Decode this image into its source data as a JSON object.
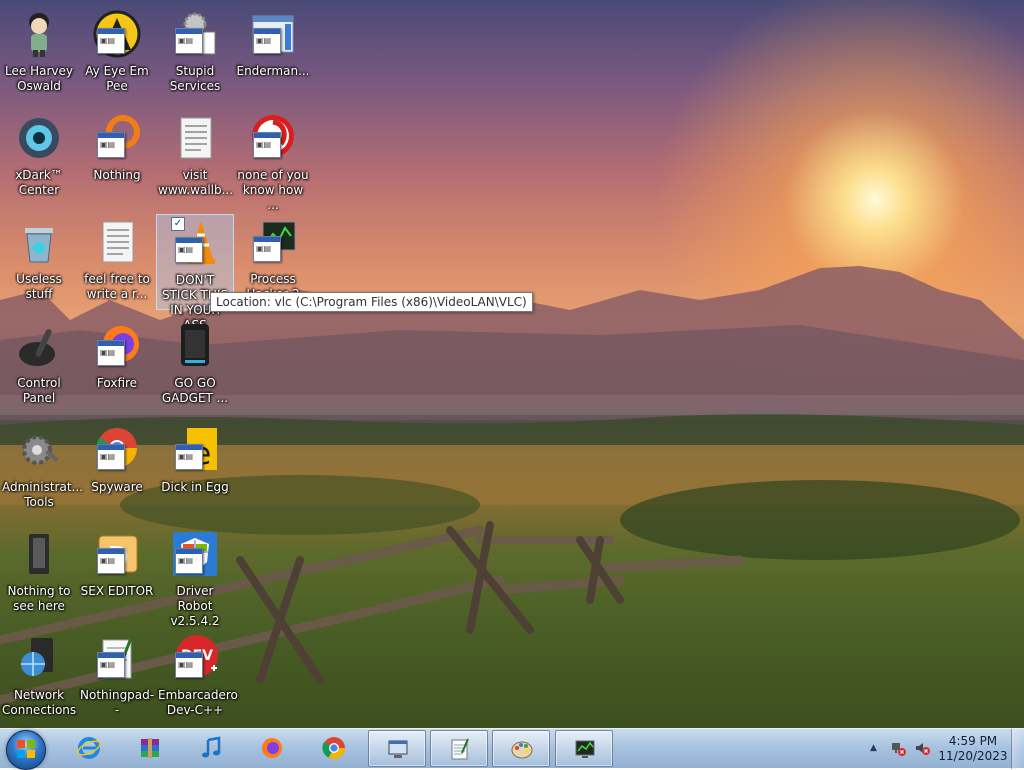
{
  "desktop": {
    "icons": [
      {
        "label": "Lee Harvey Oswald",
        "icon": "character-icon"
      },
      {
        "label": "Ay Eye Em Pee",
        "icon": "aim-icon"
      },
      {
        "label": "Stupid Services",
        "icon": "services-gear-icon"
      },
      {
        "label": "Enderman...",
        "icon": "window-app-icon"
      },
      {
        "label": "xDark™ Center",
        "icon": "dark-center-icon"
      },
      {
        "label": "Nothing",
        "icon": "orange-ring-icon"
      },
      {
        "label": "visit www.wallb...",
        "icon": "text-document-icon"
      },
      {
        "label": "none of you know how ...",
        "icon": "red-app-icon"
      },
      {
        "label": "Useless stuff",
        "icon": "recycle-bin-icon"
      },
      {
        "label": "feel free to write a r...",
        "icon": "text-document-icon"
      },
      {
        "label": "DON'T STICK THIS IN YOUR ASS",
        "icon": "vlc-cone-icon"
      },
      {
        "label": "Process Hacker 2",
        "icon": "process-monitor-icon"
      },
      {
        "label": "Control Panel",
        "icon": "control-panel-icon"
      },
      {
        "label": "Foxfire",
        "icon": "firefox-icon"
      },
      {
        "label": "GO GO GADGET ...",
        "icon": "gadget-icon"
      },
      {
        "label": "Administrat... Tools",
        "icon": "admin-tools-icon"
      },
      {
        "label": "Spyware",
        "icon": "chrome-icon"
      },
      {
        "label": "Dick in Egg",
        "icon": "dev-editor-icon"
      },
      {
        "label": "Nothing to see here",
        "icon": "empty-folder-icon"
      },
      {
        "label": "SEX EDITOR",
        "icon": "editor-icon"
      },
      {
        "label": "Driver Robot v2.5.4.2",
        "icon": "shield-icon"
      },
      {
        "label": "Network Connections",
        "icon": "network-globe-icon"
      },
      {
        "label": "Nothingpad--",
        "icon": "notepad-icon"
      },
      {
        "label": "Embarcadero Dev-C++",
        "icon": "dev-cpp-icon"
      }
    ],
    "tooltip": "Location: vlc (C:\\Program Files (x86)\\VideoLAN\\VLC)"
  },
  "taskbar": {
    "start_icon": "windows-start-orb-icon",
    "pinned": [
      {
        "name": "internet-explorer-icon"
      },
      {
        "name": "winrar-icon"
      },
      {
        "name": "music-player-icon"
      },
      {
        "name": "firefox-icon"
      },
      {
        "name": "chrome-icon"
      },
      {
        "name": "computer-window-icon"
      },
      {
        "name": "notepad-icon"
      },
      {
        "name": "paint-icon"
      },
      {
        "name": "process-monitor-icon"
      }
    ],
    "tray": {
      "time": "4:59 PM",
      "date": "11/20/2023"
    }
  },
  "colors": {
    "taskbar_top": "#c9dcef",
    "taskbar_bottom": "#93b1d3",
    "selection": "#aac8f0"
  }
}
